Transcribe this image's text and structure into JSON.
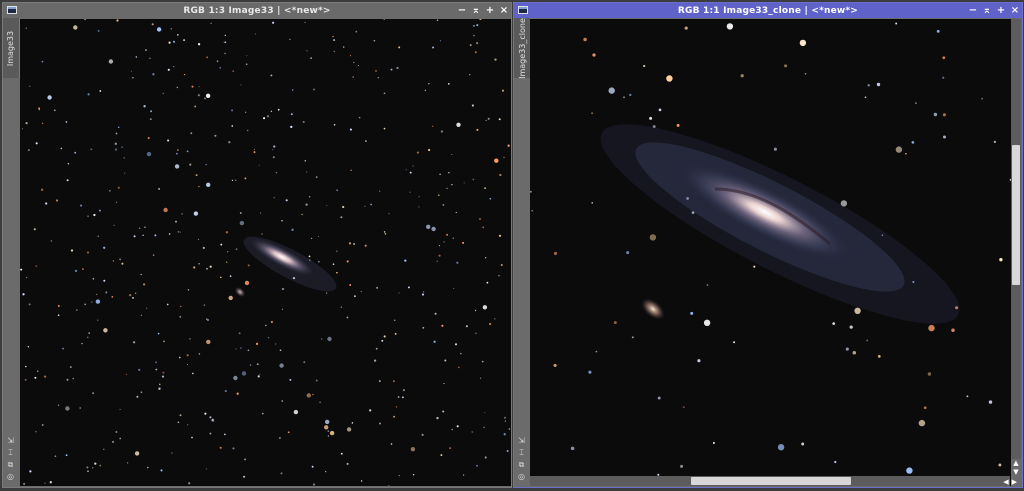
{
  "windows": [
    {
      "title": "RGB 1:3 Image33 | <*new*>",
      "side_tab": "Image33",
      "active": false
    },
    {
      "title": "RGB 1:1 Image33_clone | <*new*>",
      "side_tab": "Image33_clone",
      "active": true
    }
  ],
  "controls": {
    "minimize": "−",
    "shade": "⌅",
    "maximize": "+",
    "close": "×"
  },
  "scroll": {
    "vertical_position": 0.42,
    "vertical_size": 0.32,
    "horizontal_position": 0.5,
    "horizontal_size": 0.33
  },
  "colors": {
    "active_title": "#5f63c9",
    "inactive_title": "#6a6a6a",
    "sky": "#0b0b0c"
  }
}
